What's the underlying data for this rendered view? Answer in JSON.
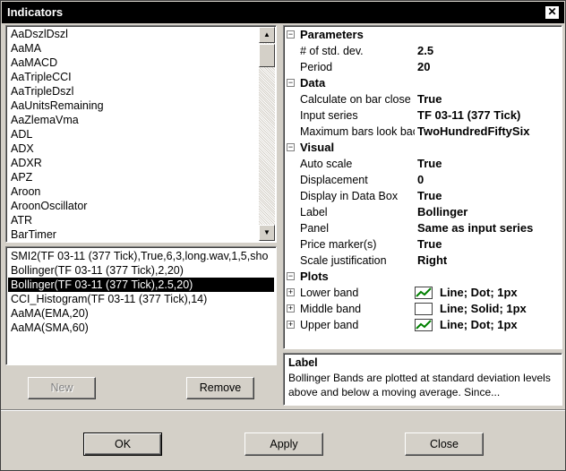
{
  "window": {
    "title": "Indicators",
    "close_glyph": "✕"
  },
  "indicator_list": {
    "items": [
      "AaDszlDszl",
      "AaMA",
      "AaMACD",
      "AaTripleCCI",
      "AaTripleDszl",
      "AaUnitsRemaining",
      "AaZlemaVma",
      "ADL",
      "ADX",
      "ADXR",
      "APZ",
      "Aroon",
      "AroonOscillator",
      "ATR",
      "BarTimer"
    ],
    "scroll_up_glyph": "▲",
    "scroll_down_glyph": "▼"
  },
  "applied_list": {
    "items": [
      "SMI2(TF 03-11 (377 Tick),True,6,3,long.wav,1,5,sho",
      "Bollinger(TF 03-11 (377 Tick),2,20)",
      "Bollinger(TF 03-11 (377 Tick),2.5,20)",
      "CCI_Histogram(TF 03-11 (377 Tick),14)",
      "AaMA(EMA,20)",
      "AaMA(SMA,60)"
    ],
    "selected_index": 2
  },
  "buttons": {
    "new": "New",
    "remove": "Remove",
    "ok": "OK",
    "apply": "Apply",
    "close": "Close"
  },
  "properties": {
    "collapse_glyph": "⊟",
    "expand_glyph": "⊞",
    "categories": {
      "parameters": "Parameters",
      "data": "Data",
      "visual": "Visual",
      "plots": "Plots"
    },
    "parameters": [
      {
        "name": "# of std. dev.",
        "value": "2.5"
      },
      {
        "name": "Period",
        "value": "20"
      }
    ],
    "data": [
      {
        "name": "Calculate on bar close",
        "value": "True"
      },
      {
        "name": "Input series",
        "value": "TF 03-11 (377 Tick)"
      },
      {
        "name": "Maximum bars look back",
        "value": "TwoHundredFiftySix"
      }
    ],
    "visual": [
      {
        "name": "Auto scale",
        "value": "True"
      },
      {
        "name": "Displacement",
        "value": "0"
      },
      {
        "name": "Display in Data Box",
        "value": "True"
      },
      {
        "name": "Label",
        "value": "Bollinger"
      },
      {
        "name": "Panel",
        "value": "Same as input series"
      },
      {
        "name": "Price marker(s)",
        "value": "True"
      },
      {
        "name": "Scale justification",
        "value": "Right"
      }
    ],
    "plots": [
      {
        "name": "Lower band",
        "value": "Line; Dot; 1px",
        "swatch": "line-chart-icon",
        "color": "#008000"
      },
      {
        "name": "Middle band",
        "value": "Line; Solid; 1px",
        "swatch": "blank-swatch",
        "color": "#ffffff"
      },
      {
        "name": "Upper band",
        "value": "Line; Dot; 1px",
        "swatch": "line-chart-icon",
        "color": "#008000"
      }
    ]
  },
  "description": {
    "title": "Label",
    "text": "Bollinger Bands are plotted at standard deviation levels above and below a moving average. Since..."
  }
}
